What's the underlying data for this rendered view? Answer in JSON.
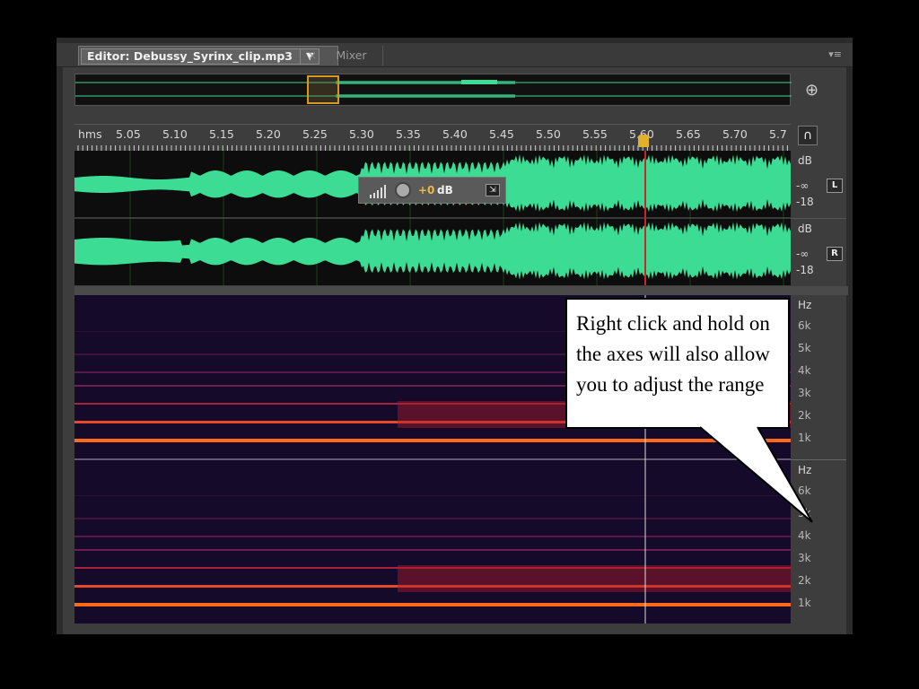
{
  "tabs": {
    "editor_label": "Editor: Debussy_Syrinx_clip.mp3",
    "editor_dropdown": "▼",
    "close_glyph": "×",
    "mixer_label": "Mixer",
    "panel_menu": "▾≡"
  },
  "ruler": {
    "unit": "hms",
    "ticks": [
      "5.05",
      "5.10",
      "5.15",
      "5.20",
      "5.25",
      "5.30",
      "5.35",
      "5.40",
      "5.45",
      "5.50",
      "5.55",
      "5.60",
      "5.65",
      "5.70",
      "5.7"
    ]
  },
  "waveform": {
    "color": "#3ddc94",
    "channel_left": {
      "button": "L",
      "unit": "dB",
      "inf": "-∞",
      "low": "-18"
    },
    "channel_right": {
      "button": "R",
      "unit": "dB",
      "inf": "-∞",
      "low": "-18"
    }
  },
  "hud": {
    "value": "+0",
    "unit": "dB"
  },
  "spectral_scale": {
    "unit": "Hz",
    "labels": [
      "6k",
      "5k",
      "4k",
      "3k",
      "2k",
      "1k"
    ]
  },
  "callout": {
    "text": "Right click and hold on the axes will also allow you to adjust the range"
  },
  "icons": {
    "zoom": "zoom-icon",
    "snap": "magnet-icon"
  }
}
